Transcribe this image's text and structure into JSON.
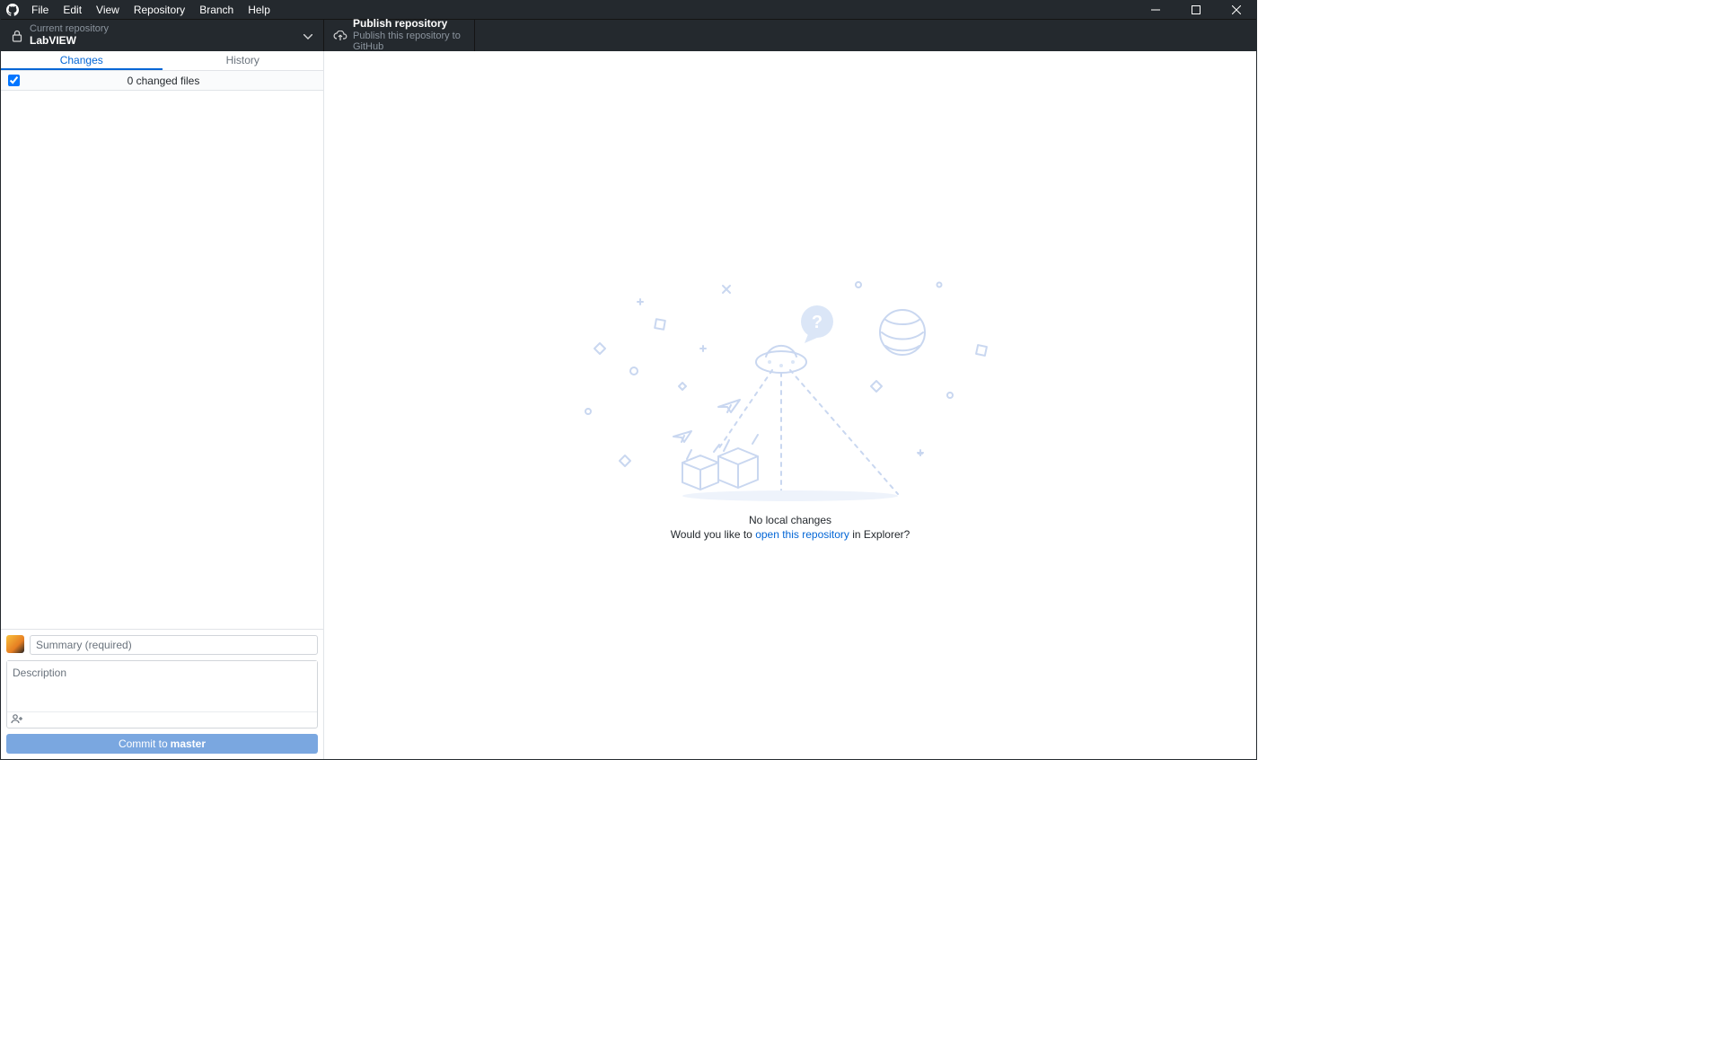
{
  "menu": {
    "items": [
      "File",
      "Edit",
      "View",
      "Repository",
      "Branch",
      "Help"
    ]
  },
  "toolbar": {
    "repo": {
      "label_top": "Current repository",
      "label_bottom": "LabVIEW"
    },
    "publish": {
      "label_top": "Publish repository",
      "label_bottom": "Publish this repository to GitHub"
    }
  },
  "sidebar": {
    "tabs": {
      "changes": "Changes",
      "history": "History"
    },
    "changes_count_label": "0 changed files"
  },
  "commit": {
    "summary_placeholder": "Summary (required)",
    "description_placeholder": "Description",
    "button_prefix": "Commit to ",
    "button_branch": "master"
  },
  "main": {
    "title": "No local changes",
    "sub_prefix": "Would you like to ",
    "sub_link": "open this repository",
    "sub_suffix": " in Explorer?"
  }
}
